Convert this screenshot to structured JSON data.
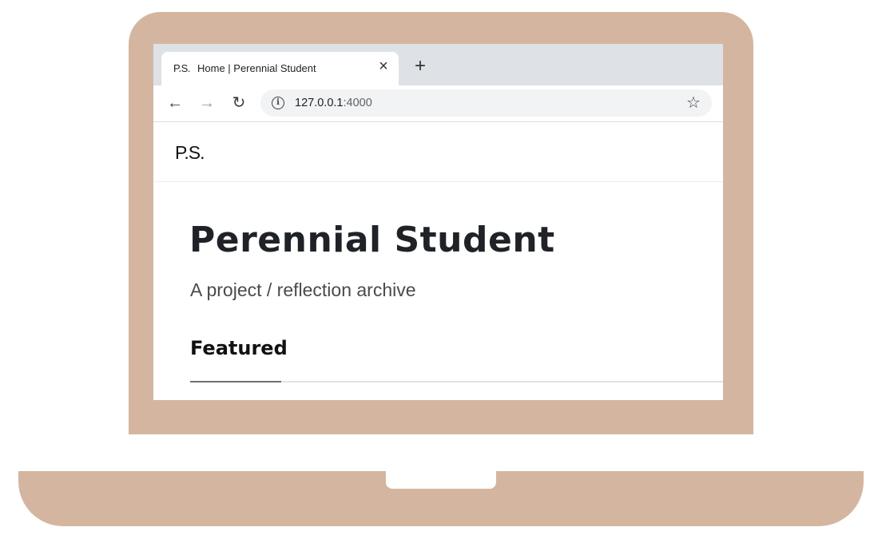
{
  "colors": {
    "laptop_body": "#d4b6a0",
    "tabstrip_bg": "#dee1e6",
    "omnibox_bg": "#f1f3f4"
  },
  "browser": {
    "tab": {
      "favicon_text": "P.S.",
      "title": "Home | Perennial Student",
      "close_icon": "close-icon"
    },
    "new_tab_icon": "plus-icon",
    "nav": {
      "back_icon": "arrow-left-icon",
      "forward_icon": "arrow-right-icon",
      "reload_icon": "reload-icon"
    },
    "address": {
      "host": "127.0.0.1",
      "port": ":4000",
      "info_icon": "info-icon",
      "bookmark_icon": "star-icon"
    }
  },
  "site": {
    "logo": "P.S.",
    "title": "Perennial Student",
    "subtitle": "A project / reflection archive",
    "tabs": [
      {
        "label": "Featured",
        "active": true
      }
    ]
  }
}
